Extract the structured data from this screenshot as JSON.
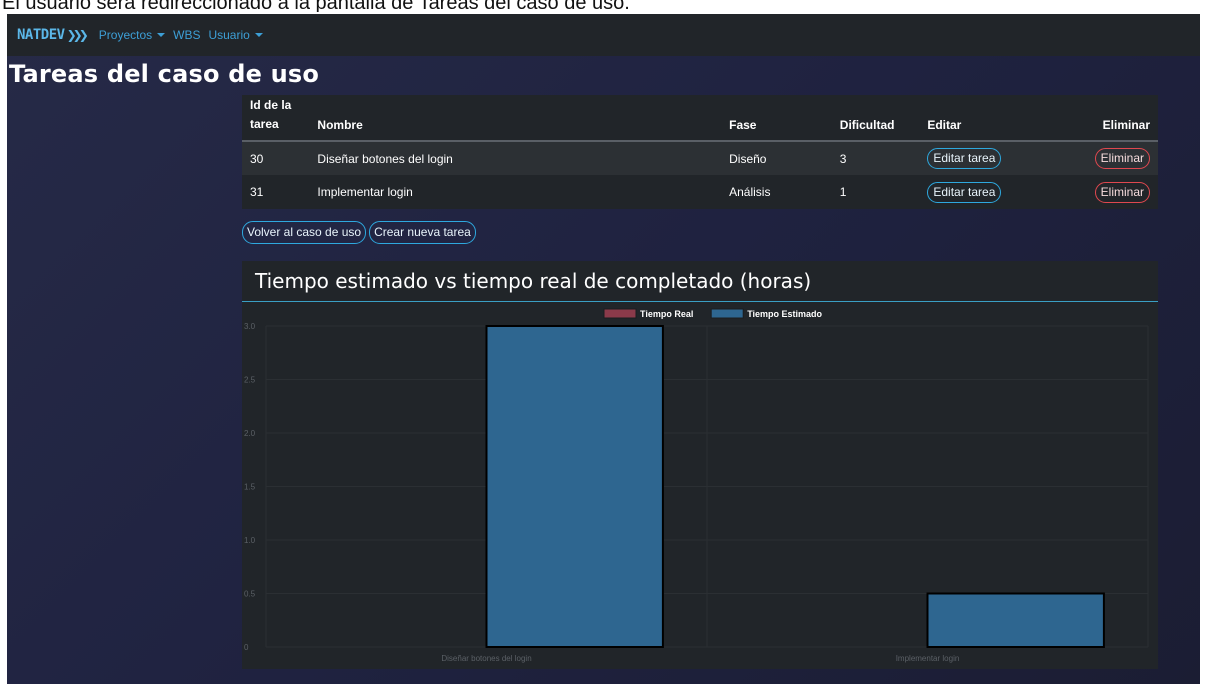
{
  "caption": "El usuario será redireccionado a la pantalla de Tareas del caso de uso.",
  "navbar": {
    "brand_prefix": "NAT",
    "brand_suffix": "DEV",
    "items": [
      {
        "label": "Proyectos",
        "dropdown": true
      },
      {
        "label": "WBS",
        "dropdown": false
      },
      {
        "label": "Usuario",
        "dropdown": true
      }
    ]
  },
  "page": {
    "title": "Tareas del caso de uso"
  },
  "table": {
    "headers": {
      "id": "Id de la tarea",
      "name": "Nombre",
      "phase": "Fase",
      "difficulty": "Dificultad",
      "edit": "Editar",
      "delete": "Eliminar"
    },
    "rows": [
      {
        "id": "30",
        "name": "Diseñar botones del login",
        "phase": "Diseño",
        "difficulty": "3",
        "edit_label": "Editar tarea",
        "delete_label": "Eliminar"
      },
      {
        "id": "31",
        "name": "Implementar login",
        "phase": "Análisis",
        "difficulty": "1",
        "edit_label": "Editar tarea",
        "delete_label": "Eliminar"
      }
    ]
  },
  "actions": {
    "back_label": "Volver al caso de uso",
    "create_label": "Crear nueva tarea"
  },
  "chart_card": {
    "title": "Tiempo estimado vs tiempo real de completado (horas)"
  },
  "chart_data": {
    "type": "bar",
    "categories": [
      "Diseñar botones del login",
      "Implementar login"
    ],
    "series": [
      {
        "name": "Tiempo Real",
        "values": [
          0,
          0
        ],
        "color": "#8b3a4a"
      },
      {
        "name": "Tiempo Estimado",
        "values": [
          3,
          0.5
        ],
        "color": "#2e6690"
      }
    ],
    "ylim": [
      0,
      3
    ],
    "yticks": [
      "0",
      "0.5",
      "1.0",
      "1.5",
      "2.0",
      "2.5",
      "3.0"
    ],
    "legend": "top",
    "grid": true
  },
  "colors": {
    "accent": "#3d9fd6",
    "info_outline": "#2ea8de",
    "danger_outline": "#e0484f",
    "table_bg": "#212529"
  }
}
